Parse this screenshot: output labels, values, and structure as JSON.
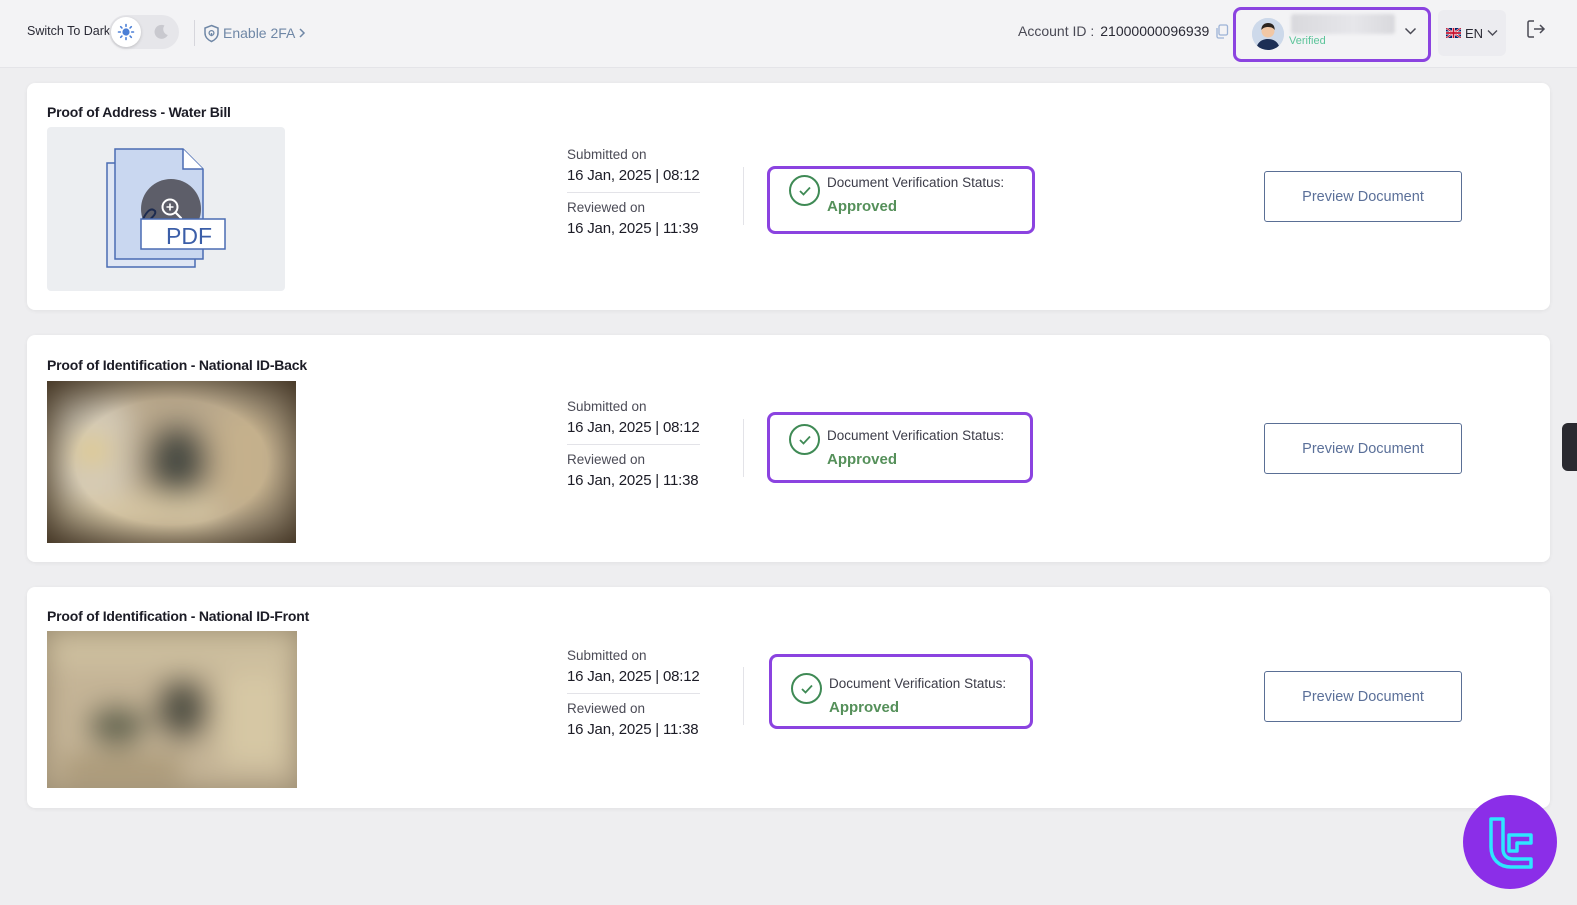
{
  "header": {
    "theme_toggle_label": "Switch To Dark",
    "enable_2fa_label": "Enable 2FA",
    "account_id_label": "Account ID :",
    "account_id_value": "21000000096939",
    "profile_status": "Verified",
    "language": "EN"
  },
  "documents": [
    {
      "title": "Proof of Address - Water Bill",
      "thumbnail_type": "pdf",
      "pdf_label": "PDF",
      "submitted_label": "Submitted on",
      "submitted_value": "16 Jan, 2025 | 08:12",
      "reviewed_label": "Reviewed on",
      "reviewed_value": "16 Jan, 2025 | 11:39",
      "status_label": "Document Verification Status:",
      "status_value": "Approved",
      "preview_label": "Preview Document"
    },
    {
      "title": "Proof of Identification - National ID-Back",
      "thumbnail_type": "blurred-photo",
      "submitted_label": "Submitted on",
      "submitted_value": "16 Jan, 2025 | 08:12",
      "reviewed_label": "Reviewed on",
      "reviewed_value": "16 Jan, 2025 | 11:38",
      "status_label": "Document Verification Status:",
      "status_value": "Approved",
      "preview_label": "Preview Document"
    },
    {
      "title": "Proof of Identification - National ID-Front",
      "thumbnail_type": "blurred-photo",
      "submitted_label": "Submitted on",
      "submitted_value": "16 Jan, 2025 | 08:12",
      "reviewed_label": "Reviewed on",
      "reviewed_value": "16 Jan, 2025 | 11:38",
      "status_label": "Document Verification Status:",
      "status_value": "Approved",
      "preview_label": "Preview Document"
    }
  ],
  "colors": {
    "highlight": "#8b43e0",
    "approved": "#55905a",
    "verified": "#5cc49a",
    "button_border": "#5a6f95"
  },
  "icons": [
    "sun-icon",
    "moon-icon",
    "shield-icon",
    "chevron-right-icon",
    "copy-icon",
    "avatar",
    "chevron-down-icon",
    "flag-uk-icon",
    "logout-icon",
    "pdf-icon",
    "check-circle-icon",
    "brand-logo-icon"
  ]
}
